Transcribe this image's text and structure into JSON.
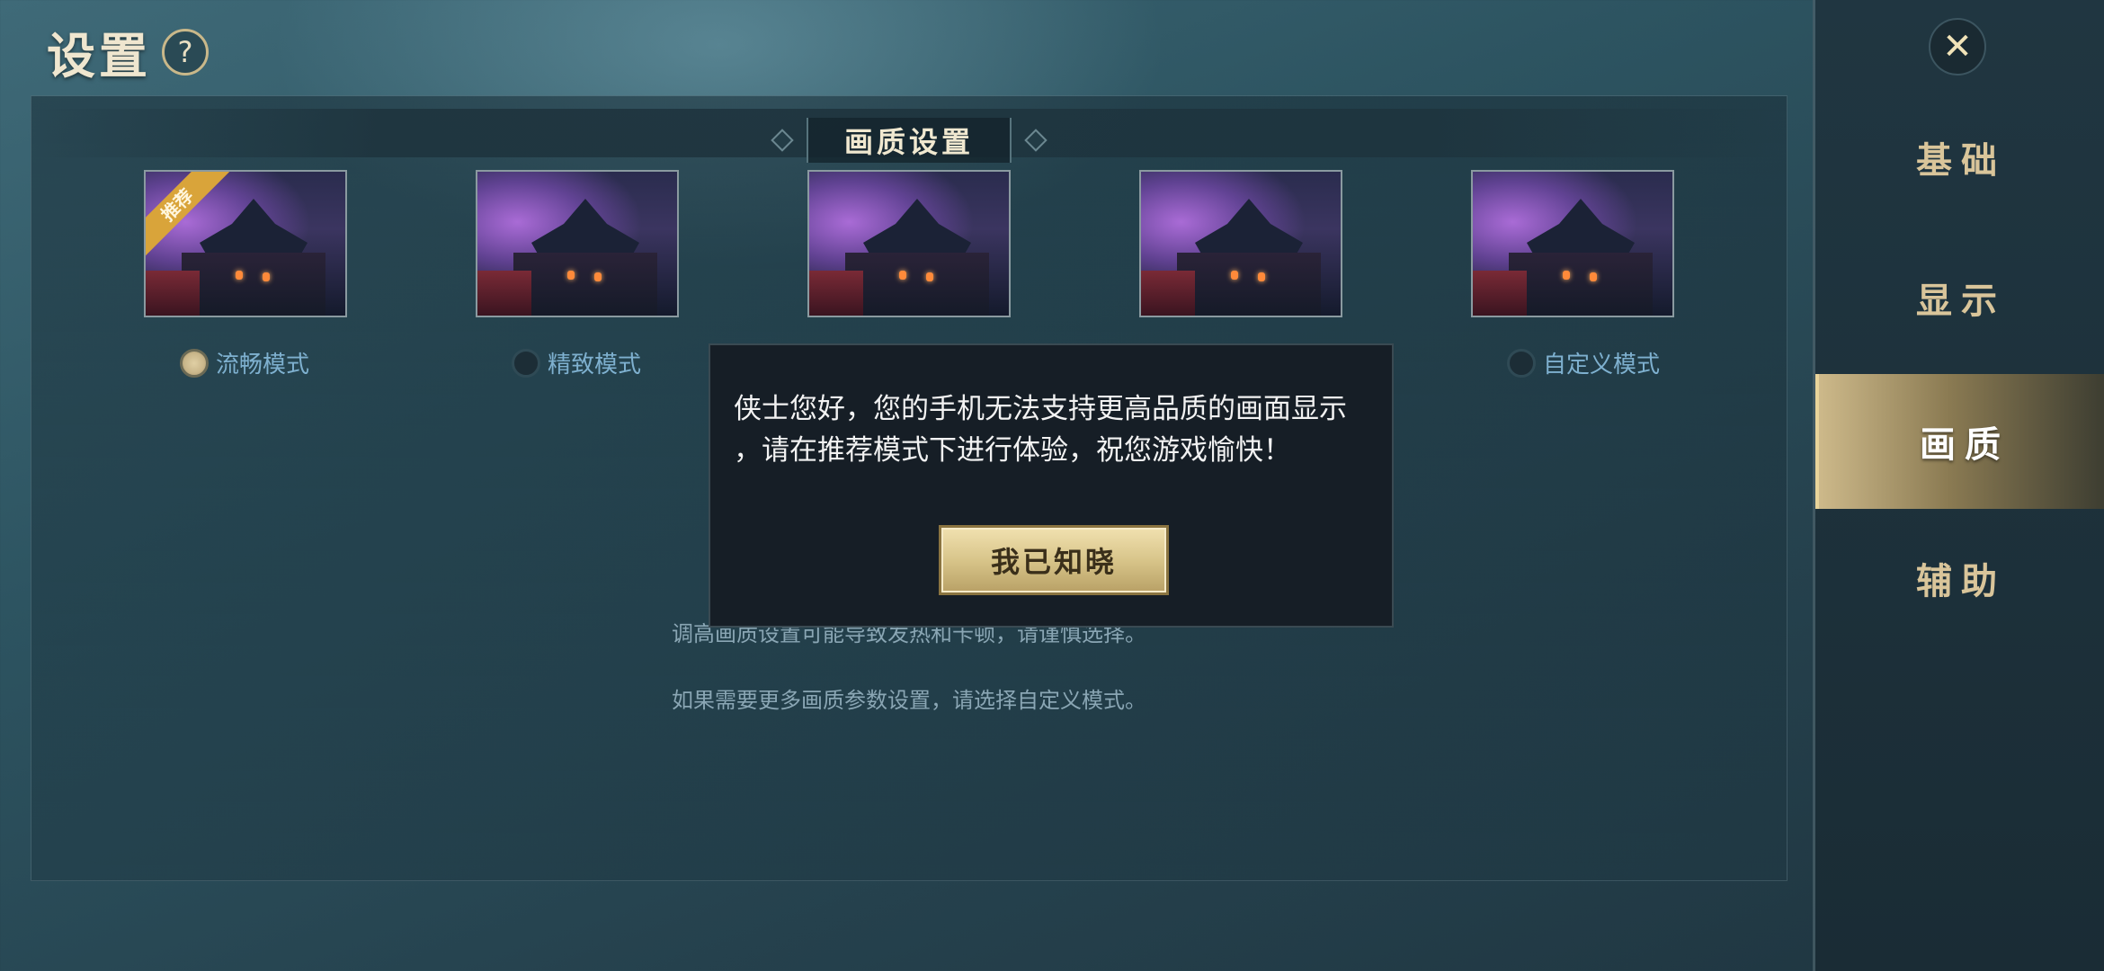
{
  "header": {
    "title": "设置",
    "help_icon_label": "?"
  },
  "section": {
    "title": "画质设置"
  },
  "modes": [
    {
      "label": "流畅模式",
      "badge": "推荐",
      "selected": true
    },
    {
      "label": "精致模式",
      "selected": false
    },
    {
      "label": "",
      "selected": false
    },
    {
      "label": "",
      "selected": false
    },
    {
      "label": "自定义模式",
      "selected": false
    }
  ],
  "tips": {
    "line1": "调高画质设置可能导致发热和卡顿，请谨慎选择。",
    "line2": "如果需要更多画质参数设置，请选择自定义模式。"
  },
  "sidebar": {
    "close_label": "✕",
    "items": [
      {
        "label": "基础",
        "active": false
      },
      {
        "label": "显示",
        "active": false
      },
      {
        "label": "画质",
        "active": true
      },
      {
        "label": "辅助",
        "active": false
      }
    ]
  },
  "dialog": {
    "message": "侠士您好，您的手机无法支持更高品质的画面显示\n，请在推荐模式下进行体验，祝您游戏愉快！",
    "confirm_label": "我已知晓"
  },
  "colors": {
    "accent_gold": "#d8c58a",
    "label_blue": "#7eb0cf"
  }
}
